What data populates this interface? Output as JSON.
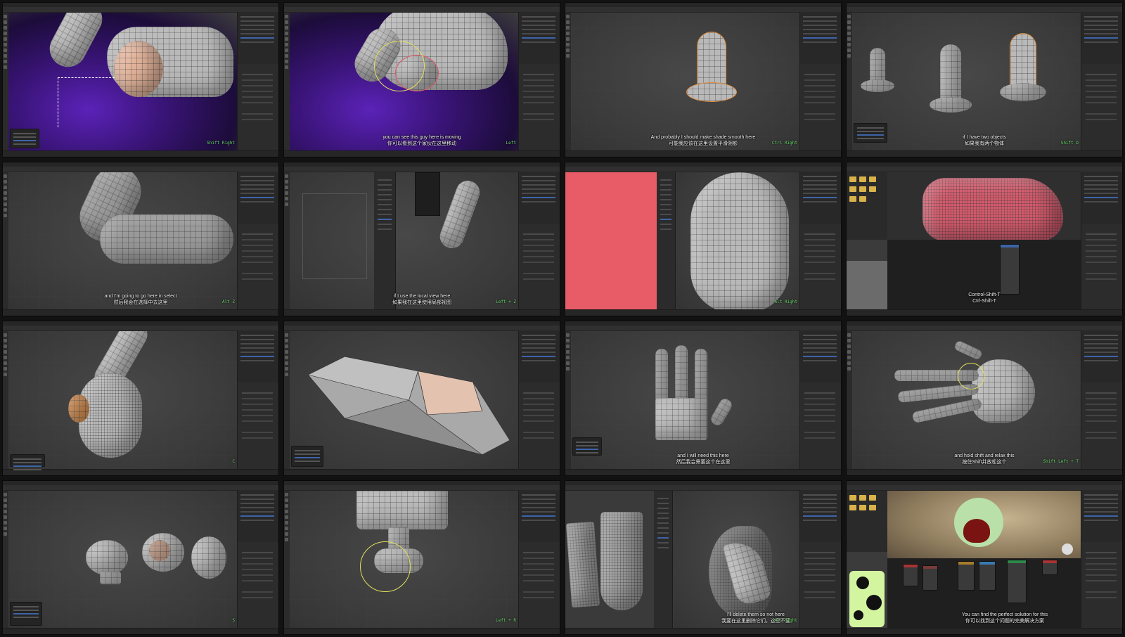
{
  "panels": [
    {
      "caption_en": "",
      "caption_zh": "",
      "keys": "Shift Right"
    },
    {
      "caption_en": "you can see this guy here is moving",
      "caption_zh": "你可以看到这个家伙在这里移动",
      "keys": "Left"
    },
    {
      "caption_en": "And probably I should make shade smooth here",
      "caption_zh": "可能我应该在这里设置平滑阴影",
      "keys": "Ctrl Right"
    },
    {
      "caption_en": "if I have two objects",
      "caption_zh": "如果我有两个物体",
      "keys": "Shift D"
    },
    {
      "caption_en": "and I'm going to go here in select",
      "caption_zh": "然后我会在选择中去这里",
      "keys": "Alt Z"
    },
    {
      "caption_en": "if I use the local view here",
      "caption_zh": "如果我在这里使用局部视图",
      "keys": "Left + Z"
    },
    {
      "caption_en": "",
      "caption_zh": "",
      "keys": "Alt Right"
    },
    {
      "caption_en": "Control-Shift-T",
      "caption_zh": "Ctrl-Shift-T",
      "keys": ""
    },
    {
      "caption_en": "",
      "caption_zh": "",
      "keys": "C"
    },
    {
      "caption_en": "",
      "caption_zh": "",
      "keys": ""
    },
    {
      "caption_en": "and I will need this here",
      "caption_zh": "然后我会需要这个在这里",
      "keys": ""
    },
    {
      "caption_en": "and hold shift and relax this",
      "caption_zh": "按住Shift并放松这个",
      "keys": "Shift Left + T"
    },
    {
      "caption_en": "",
      "caption_zh": "",
      "keys": "S"
    },
    {
      "caption_en": "",
      "caption_zh": "",
      "keys": "Left + R"
    },
    {
      "caption_en": "I'll delete them so not here",
      "caption_zh": "我要在这里删除它们，这里不要",
      "keys": "Alt Right"
    },
    {
      "caption_en": "You can find the perfect solution for this",
      "caption_zh": "你可以找到这个问题的完美解决方案",
      "keys": ""
    }
  ],
  "icons": {
    "brush": "brush-circle-icon",
    "folder": "folder-icon"
  },
  "colors": {
    "accent": "#3e64a8",
    "keyhint": "#63d863",
    "brush": "#e0e060",
    "selection": "#e3b39a"
  }
}
